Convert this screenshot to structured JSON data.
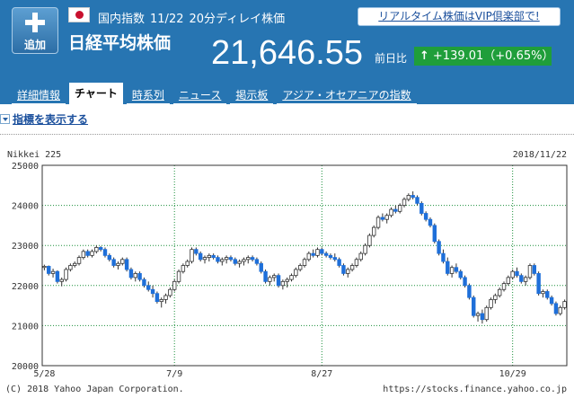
{
  "header": {
    "add_button_label": "追加",
    "market": "国内指数",
    "date": "11/22",
    "delay_note": "20分ディレイ株価",
    "index_name": "日経平均株価",
    "price": "21,646.55",
    "prev_label": "前日比",
    "change": "+139.01（+0.65%）",
    "vip_link": "リアルタイム株価はVIP倶楽部で!"
  },
  "tabs": [
    {
      "label": "詳細情報",
      "active": false
    },
    {
      "label": "チャート",
      "active": true
    },
    {
      "label": "時系列",
      "active": false
    },
    {
      "label": "ニュース",
      "active": false
    },
    {
      "label": "掲示板",
      "active": false
    },
    {
      "label": "アジア・オセアニアの指数",
      "active": false
    }
  ],
  "toggle_indices": "指標を表示する",
  "colors": {
    "header": "#2775b2",
    "up_badge": "#1f9e3a",
    "candle_down": "#1e6fd9",
    "grid": "#1a8f3a"
  },
  "chart_data": {
    "type": "candlestick",
    "title": "Nikkei 225",
    "date_label": "2018/11/22",
    "copyright": "(C) 2018 Yahoo Japan Corporation.",
    "source": "https://stocks.finance.yahoo.co.jp",
    "ylim": [
      20000,
      25000
    ],
    "yticks": [
      20000,
      21000,
      22000,
      23000,
      24000,
      25000
    ],
    "xticks": [
      {
        "label": "5/28",
        "index": 0
      },
      {
        "label": "7/9",
        "index": 30
      },
      {
        "label": "8/27",
        "index": 64
      },
      {
        "label": "10/29",
        "index": 108
      }
    ],
    "candles": [
      [
        22450,
        22520,
        22380,
        22480
      ],
      [
        22480,
        22500,
        22250,
        22300
      ],
      [
        22300,
        22420,
        22200,
        22350
      ],
      [
        22350,
        22380,
        22050,
        22100
      ],
      [
        22100,
        22200,
        21980,
        22150
      ],
      [
        22150,
        22450,
        22100,
        22400
      ],
      [
        22400,
        22550,
        22350,
        22500
      ],
      [
        22500,
        22600,
        22450,
        22550
      ],
      [
        22550,
        22750,
        22500,
        22700
      ],
      [
        22700,
        22900,
        22650,
        22850
      ],
      [
        22850,
        22900,
        22700,
        22750
      ],
      [
        22750,
        22900,
        22700,
        22850
      ],
      [
        22850,
        23000,
        22800,
        22950
      ],
      [
        22950,
        22980,
        22850,
        22900
      ],
      [
        22900,
        22950,
        22700,
        22750
      ],
      [
        22750,
        22800,
        22600,
        22650
      ],
      [
        22650,
        22700,
        22450,
        22500
      ],
      [
        22500,
        22600,
        22400,
        22550
      ],
      [
        22550,
        22700,
        22500,
        22650
      ],
      [
        22650,
        22700,
        22350,
        22400
      ],
      [
        22400,
        22450,
        22150,
        22200
      ],
      [
        22200,
        22350,
        22100,
        22300
      ],
      [
        22300,
        22350,
        22100,
        22150
      ],
      [
        22150,
        22200,
        21950,
        22000
      ],
      [
        22000,
        22100,
        21850,
        21900
      ],
      [
        21900,
        22000,
        21700,
        21800
      ],
      [
        21800,
        21850,
        21550,
        21600
      ],
      [
        21600,
        21700,
        21450,
        21650
      ],
      [
        21650,
        21800,
        21550,
        21750
      ],
      [
        21750,
        21950,
        21700,
        21900
      ],
      [
        21900,
        22150,
        21850,
        22100
      ],
      [
        22100,
        22400,
        22050,
        22350
      ],
      [
        22350,
        22550,
        22300,
        22500
      ],
      [
        22500,
        22650,
        22450,
        22600
      ],
      [
        22600,
        22950,
        22550,
        22900
      ],
      [
        22900,
        22950,
        22750,
        22800
      ],
      [
        22800,
        22850,
        22600,
        22650
      ],
      [
        22650,
        22750,
        22550,
        22700
      ],
      [
        22700,
        22800,
        22600,
        22750
      ],
      [
        22750,
        22800,
        22650,
        22700
      ],
      [
        22700,
        22750,
        22550,
        22600
      ],
      [
        22600,
        22700,
        22500,
        22650
      ],
      [
        22650,
        22750,
        22550,
        22700
      ],
      [
        22700,
        22750,
        22600,
        22650
      ],
      [
        22650,
        22700,
        22500,
        22550
      ],
      [
        22550,
        22650,
        22450,
        22600
      ],
      [
        22600,
        22700,
        22500,
        22650
      ],
      [
        22650,
        22750,
        22550,
        22700
      ],
      [
        22700,
        22750,
        22600,
        22650
      ],
      [
        22650,
        22700,
        22500,
        22550
      ],
      [
        22550,
        22600,
        22300,
        22350
      ],
      [
        22350,
        22400,
        22050,
        22100
      ],
      [
        22100,
        22250,
        22000,
        22200
      ],
      [
        22200,
        22300,
        22100,
        22250
      ],
      [
        22250,
        22300,
        21950,
        22000
      ],
      [
        22000,
        22150,
        21900,
        22100
      ],
      [
        22100,
        22200,
        21950,
        22150
      ],
      [
        22150,
        22300,
        22100,
        22250
      ],
      [
        22250,
        22450,
        22200,
        22400
      ],
      [
        22400,
        22550,
        22350,
        22500
      ],
      [
        22500,
        22700,
        22450,
        22650
      ],
      [
        22650,
        22850,
        22600,
        22800
      ],
      [
        22800,
        22900,
        22700,
        22750
      ],
      [
        22750,
        22950,
        22700,
        22900
      ],
      [
        22900,
        22950,
        22750,
        22800
      ],
      [
        22800,
        22850,
        22700,
        22750
      ],
      [
        22750,
        22800,
        22650,
        22700
      ],
      [
        22700,
        22800,
        22600,
        22650
      ],
      [
        22650,
        22700,
        22450,
        22500
      ],
      [
        22500,
        22550,
        22250,
        22300
      ],
      [
        22300,
        22450,
        22200,
        22400
      ],
      [
        22400,
        22550,
        22350,
        22500
      ],
      [
        22500,
        22700,
        22450,
        22650
      ],
      [
        22650,
        22850,
        22600,
        22800
      ],
      [
        22800,
        23050,
        22750,
        23000
      ],
      [
        23000,
        23300,
        22950,
        23250
      ],
      [
        23250,
        23500,
        23200,
        23450
      ],
      [
        23450,
        23750,
        23400,
        23700
      ],
      [
        23700,
        23800,
        23600,
        23650
      ],
      [
        23650,
        23800,
        23550,
        23750
      ],
      [
        23750,
        23950,
        23700,
        23900
      ],
      [
        23900,
        24000,
        23800,
        23850
      ],
      [
        23850,
        24050,
        23800,
        24000
      ],
      [
        24000,
        24200,
        23950,
        24150
      ],
      [
        24150,
        24300,
        24100,
        24250
      ],
      [
        24250,
        24350,
        24150,
        24200
      ],
      [
        24200,
        24250,
        24000,
        24050
      ],
      [
        24050,
        24100,
        23750,
        23800
      ],
      [
        23800,
        23850,
        23600,
        23650
      ],
      [
        23650,
        23700,
        23450,
        23500
      ],
      [
        23500,
        23550,
        23050,
        23100
      ],
      [
        23100,
        23150,
        22750,
        22800
      ],
      [
        22800,
        22900,
        22550,
        22600
      ],
      [
        22600,
        22700,
        22250,
        22300
      ],
      [
        22300,
        22500,
        22200,
        22450
      ],
      [
        22450,
        22550,
        22300,
        22350
      ],
      [
        22350,
        22400,
        22150,
        22200
      ],
      [
        22200,
        22250,
        21950,
        22000
      ],
      [
        22000,
        22050,
        21650,
        21700
      ],
      [
        21700,
        21750,
        21200,
        21250
      ],
      [
        21250,
        21350,
        21100,
        21300
      ],
      [
        21300,
        21400,
        21050,
        21150
      ],
      [
        21150,
        21500,
        21100,
        21450
      ],
      [
        21450,
        21700,
        21400,
        21650
      ],
      [
        21650,
        21800,
        21550,
        21750
      ],
      [
        21750,
        21950,
        21700,
        21900
      ],
      [
        21900,
        22100,
        21850,
        22050
      ],
      [
        22050,
        22250,
        22000,
        22200
      ],
      [
        22200,
        22400,
        22150,
        22350
      ],
      [
        22350,
        22450,
        22200,
        22250
      ],
      [
        22250,
        22300,
        22050,
        22100
      ],
      [
        22100,
        22250,
        22000,
        22200
      ],
      [
        22200,
        22550,
        22150,
        22500
      ],
      [
        22500,
        22550,
        22250,
        22300
      ],
      [
        22300,
        22350,
        21750,
        21800
      ],
      [
        21800,
        21900,
        21700,
        21850
      ],
      [
        21850,
        21900,
        21650,
        21700
      ],
      [
        21700,
        21750,
        21500,
        21550
      ],
      [
        21550,
        21600,
        21250,
        21300
      ],
      [
        21300,
        21500,
        21250,
        21450
      ],
      [
        21450,
        21650,
        21400,
        21600
      ]
    ]
  }
}
